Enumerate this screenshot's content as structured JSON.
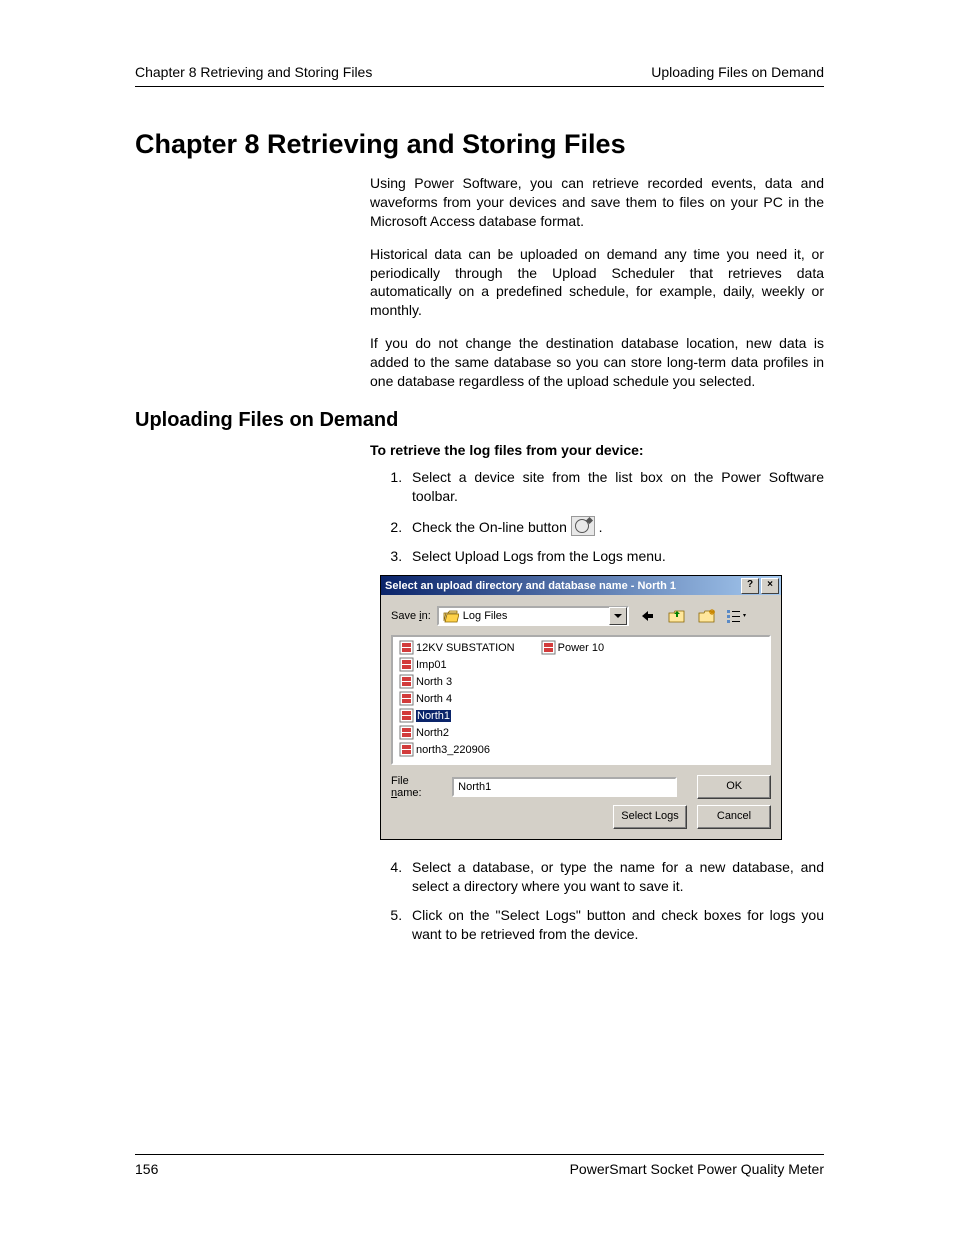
{
  "header": {
    "left": "Chapter 8 Retrieving and Storing Files",
    "right": "Uploading Files on Demand"
  },
  "chapter_title": "Chapter 8   Retrieving and Storing Files",
  "intro": {
    "p1": "Using Power Software, you can retrieve recorded events, data and waveforms from your devices and save them to files on your PC in the Microsoft Access database format.",
    "p2": "Historical data can be uploaded on demand any time you need it, or periodically through the Upload Scheduler that retrieves data automatically on a predefined schedule, for example, daily, weekly or monthly.",
    "p3": "If you do not change the destination database location, new data is added to the same database so you can store long-term data profiles in one database regardless of the upload schedule you selected."
  },
  "section_title": "Uploading Files on Demand",
  "lead": "To retrieve the log files from your device:",
  "steps": {
    "s1": "Select a device site from the list box on the Power Software toolbar.",
    "s2a": "Check the On-line button ",
    "s2b": ".",
    "s3": "Select Upload Logs from the Logs menu.",
    "s4": "Select a database, or type the name for a new database, and select a directory where you want to save it.",
    "s5": "Click on the \"Select Logs\" button and check boxes for logs you want to be retrieved from the device."
  },
  "dialog": {
    "title": "Select an upload directory and database name - North 1",
    "help_btn": "?",
    "close_btn": "×",
    "save_in_pre": "Save ",
    "save_in_u": "i",
    "save_in_post": "n:",
    "folder": "Log Files",
    "files": [
      {
        "name": "12KV SUBSTATION",
        "selected": false
      },
      {
        "name": "Imp01",
        "selected": false
      },
      {
        "name": "North 3",
        "selected": false
      },
      {
        "name": "North 4",
        "selected": false
      },
      {
        "name": "North1",
        "selected": true
      },
      {
        "name": "North2",
        "selected": false
      },
      {
        "name": "north3_220906",
        "selected": false
      },
      {
        "name": "Power 10",
        "selected": false
      }
    ],
    "filename_pre": "File ",
    "filename_u": "n",
    "filename_post": "ame:",
    "filename_value": "North1",
    "btn_ok": "OK",
    "btn_select_logs": "Select Logs",
    "btn_cancel": "Cancel"
  },
  "footer": {
    "page": "156",
    "product": "PowerSmart Socket Power Quality Meter"
  }
}
